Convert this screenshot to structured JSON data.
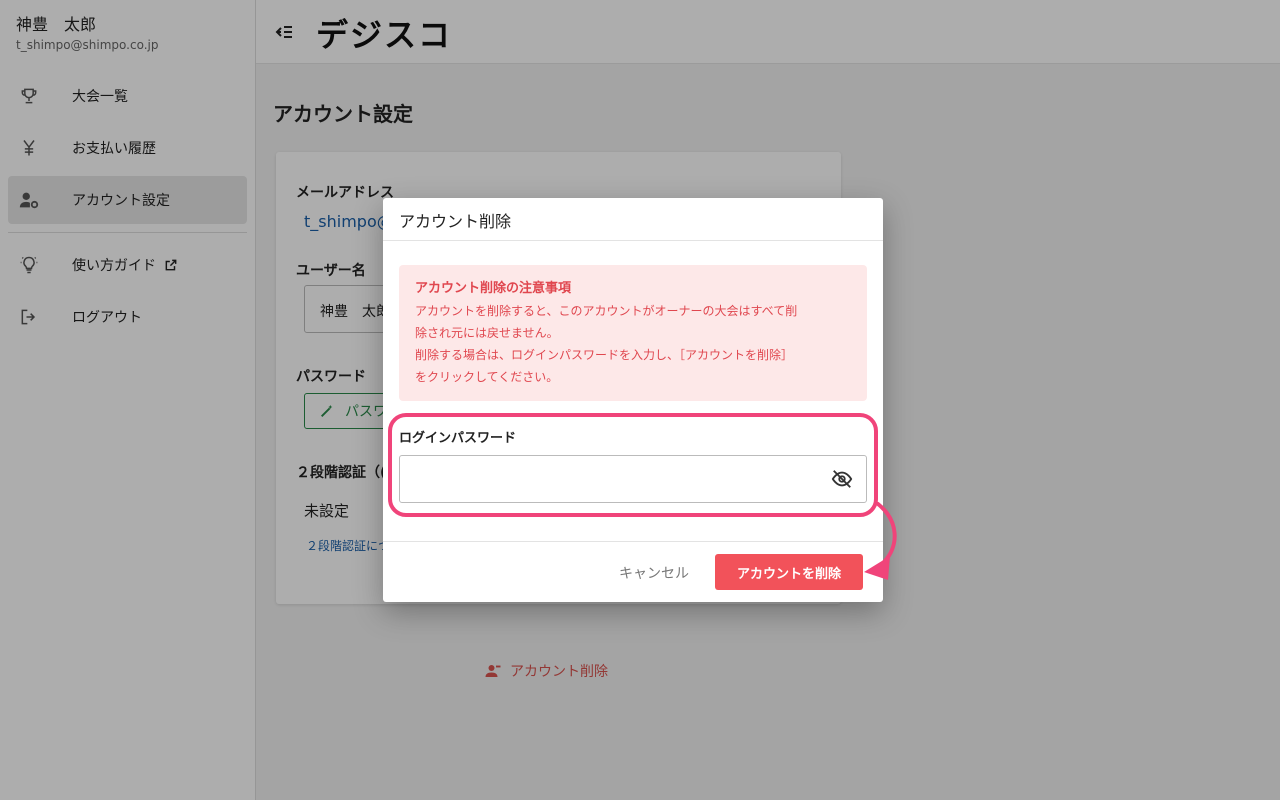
{
  "user": {
    "name": "神豊　太郎",
    "email": "t_shimpo@shimpo.co.jp"
  },
  "sidebar": {
    "items": [
      {
        "label": "大会一覧",
        "icon": "trophy-icon"
      },
      {
        "label": "お支払い履歴",
        "icon": "yen-icon"
      },
      {
        "label": "アカウント設定",
        "icon": "user-settings-icon"
      },
      {
        "label": "使い方ガイド",
        "icon": "lightbulb-icon"
      },
      {
        "label": "ログアウト",
        "icon": "logout-icon"
      }
    ]
  },
  "header": {
    "logo": "デジスコ"
  },
  "page": {
    "title": "アカウント設定",
    "email_label": "メールアドレス",
    "email_value": "t_shimpo@",
    "username_label": "ユーザー名",
    "username_value": "神豊　太郎",
    "password_label": "パスワード",
    "password_change_label": "パスワ",
    "twofa_label": "２段階認証（(",
    "twofa_status": "未設定",
    "twofa_link": "２段階認証につ",
    "delete_account_label": "アカウント削除"
  },
  "dialog": {
    "title": "アカウント削除",
    "warning_title": "アカウント削除の注意事項",
    "warning_lines": [
      "アカウントを削除すると、このアカウントがオーナーの大会はすべて削",
      "除され元には戻せません。",
      "削除する場合は、ログインパスワードを入力し、［アカウントを削除］",
      "をクリックしてください。"
    ],
    "password_label": "ログインパスワード",
    "password_value": "",
    "cancel_label": "キャンセル",
    "confirm_label": "アカウントを削除"
  },
  "colors": {
    "accent_danger": "#f2525a",
    "warning_bg": "#fde8e8",
    "warning_text": "#e0474f",
    "annotation": "#f0447a",
    "link": "#1a5fa8",
    "success": "#2a8a4a"
  }
}
